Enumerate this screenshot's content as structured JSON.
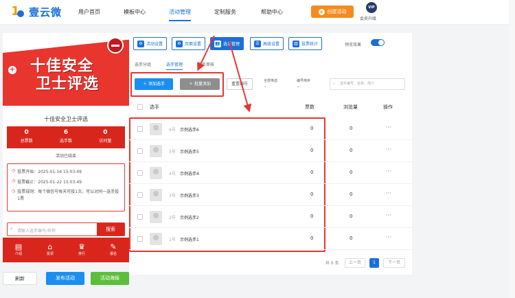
{
  "brand": {
    "logo_text": "壹云微"
  },
  "nav": [
    "用户首页",
    "模板中心",
    "活动管理",
    "定制服务",
    "帮助中心"
  ],
  "create_btn": "创建活动",
  "vip": {
    "badge": "VIP",
    "label": "会员升级"
  },
  "preview": {
    "title_line1": "十佳安全",
    "title_line2": "卫士评选",
    "card_title": "十佳安全卫士评选",
    "stats": [
      {
        "num": "0",
        "label": "总票数"
      },
      {
        "num": "6",
        "label": "选手数"
      },
      {
        "num": "0",
        "label": "访问量"
      }
    ],
    "ended": "活动已结束",
    "info": [
      "投票开始：2025-01-16 15:03:49",
      "投票截止：2025-01-22 15:03:49",
      "投票规则：每个微信号每天可投1次，可以对同一选手投1票"
    ],
    "search_placeholder": "请输入选手编号/名称",
    "search_btn": "搜索",
    "bottom_nav": [
      "介绍",
      "投票",
      "排行",
      "报名"
    ]
  },
  "footer_btns": [
    "刷新",
    "发布活动",
    "活动海报"
  ],
  "toolbar": [
    "活动设置",
    "页面设置",
    "选手管理",
    "高级设置",
    "投票统计"
  ],
  "preview_effect_label": "预览效果",
  "subtabs": [
    "选手分组",
    "选手管理",
    "报名审核"
  ],
  "actions": {
    "add": "添加选手",
    "batch": "批量添加",
    "reset": "重置编号"
  },
  "filters": {
    "all_groups": "全部筛选",
    "sort": "编号倒序"
  },
  "search_placeholder": "选手编号、名称、简介",
  "table": {
    "headers": {
      "player": "选手",
      "votes": "票数",
      "views": "浏览量",
      "ops": "操作"
    },
    "rows": [
      {
        "no": "6号",
        "name": "示例选手6",
        "votes": "0",
        "views": "0"
      },
      {
        "no": "5号",
        "name": "示例选手5",
        "votes": "0",
        "views": "0"
      },
      {
        "no": "4号",
        "name": "示例选手4",
        "votes": "0",
        "views": "0"
      },
      {
        "no": "3号",
        "name": "示例选手3",
        "votes": "0",
        "views": "0"
      },
      {
        "no": "2号",
        "name": "示例选手2",
        "votes": "0",
        "views": "0"
      },
      {
        "no": "1号",
        "name": "示例选手1",
        "votes": "0",
        "views": "0"
      }
    ]
  },
  "pager": {
    "total": "共 6 条",
    "prev": "上一页",
    "page": "1",
    "next": "下一页"
  }
}
